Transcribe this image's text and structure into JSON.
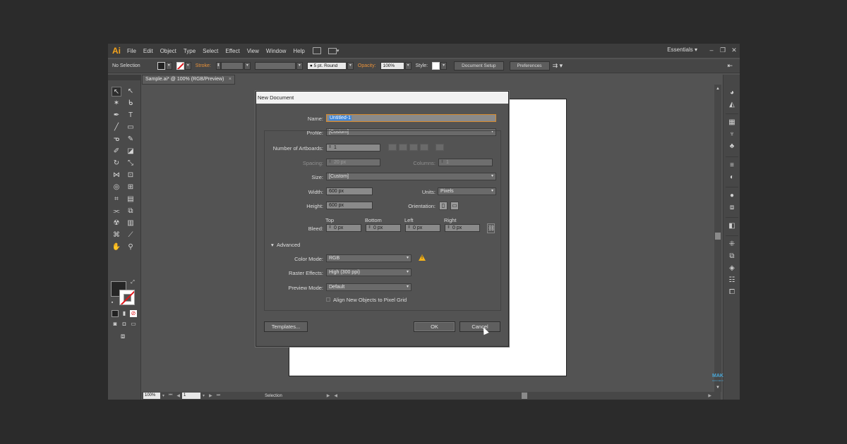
{
  "menubar": {
    "logo": "Ai",
    "items": [
      "File",
      "Edit",
      "Object",
      "Type",
      "Select",
      "Effect",
      "View",
      "Window",
      "Help"
    ],
    "workspace": "Essentials"
  },
  "controlbar": {
    "selection_status": "No Selection",
    "stroke_label": "Stroke:",
    "brush_value": "5 pt. Round",
    "opacity_label": "Opacity:",
    "opacity_value": "100%",
    "style_label": "Style:",
    "document_setup": "Document Setup",
    "preferences": "Preferences"
  },
  "document_tab": {
    "title": "Sample.ai* @ 100% (RGB/Preview)",
    "close": "×"
  },
  "statusbar": {
    "zoom": "100%",
    "artboard_number": "1",
    "status_text": "Selection"
  },
  "watermark": {
    "line1": "MAK",
    "line2": "www.mak.in"
  },
  "dialog": {
    "title": "New Document",
    "name_label": "Name:",
    "name_value": "Untitled-1",
    "profile_label": "Profile:",
    "profile_value": "[Custom]",
    "artboards_label": "Number of Artboards:",
    "artboards_value": "1",
    "spacing_label": "Spacing:",
    "spacing_value": "20 px",
    "columns_label": "Columns:",
    "columns_value": "1",
    "size_label": "Size:",
    "size_value": "[Custom]",
    "width_label": "Width:",
    "width_value": "600 px",
    "units_label": "Units:",
    "units_value": "Pixels",
    "height_label": "Height:",
    "height_value": "600 px",
    "orientation_label": "Orientation:",
    "bleed_label": "Bleed:",
    "bleed_top_label": "Top",
    "bleed_top": "0 px",
    "bleed_bottom_label": "Bottom",
    "bleed_bottom": "0 px",
    "bleed_left_label": "Left",
    "bleed_left": "0 px",
    "bleed_right_label": "Right",
    "bleed_right": "0 px",
    "advanced_label": "Advanced",
    "color_mode_label": "Color Mode:",
    "color_mode_value": "RGB",
    "raster_label": "Raster Effects:",
    "raster_value": "High (300 ppi)",
    "preview_label": "Preview Mode:",
    "preview_value": "Default",
    "align_label": "Align New Objects to Pixel Grid",
    "templates_button": "Templates...",
    "ok_button": "OK",
    "cancel_button": "Cancel"
  },
  "colors": {
    "app_bg": "#535353",
    "accent_orange": "#f4a31c",
    "selection_blue": "#3d84d6",
    "warning_yellow": "#f2b21b"
  }
}
